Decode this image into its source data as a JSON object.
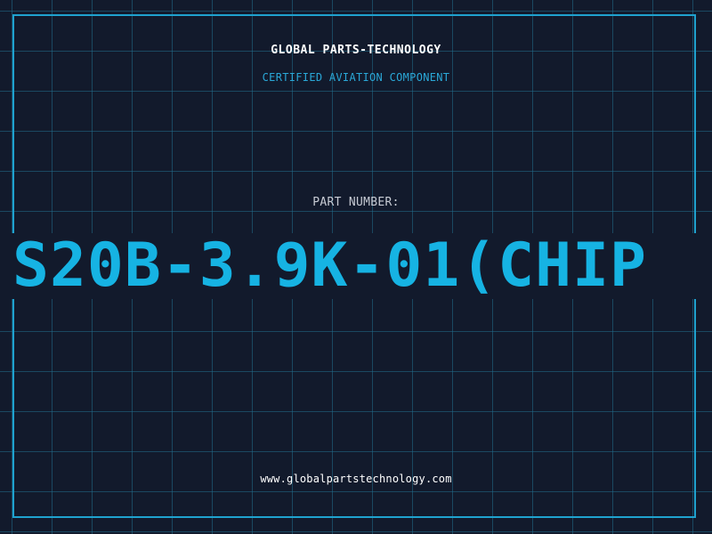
{
  "header": {
    "company": "GLOBAL PARTS-TECHNOLOGY",
    "certification": "CERTIFIED AVIATION COMPONENT"
  },
  "part": {
    "label": "PART NUMBER:",
    "number": "S20B-3.9K-01(CHIP"
  },
  "footer": {
    "website": "www.globalpartstechnology.com"
  },
  "colors": {
    "background": "#121a2c",
    "grid": "#226e8c",
    "frame": "#1fa2cf",
    "accent": "#16b3e3",
    "text": "#ffffff"
  }
}
